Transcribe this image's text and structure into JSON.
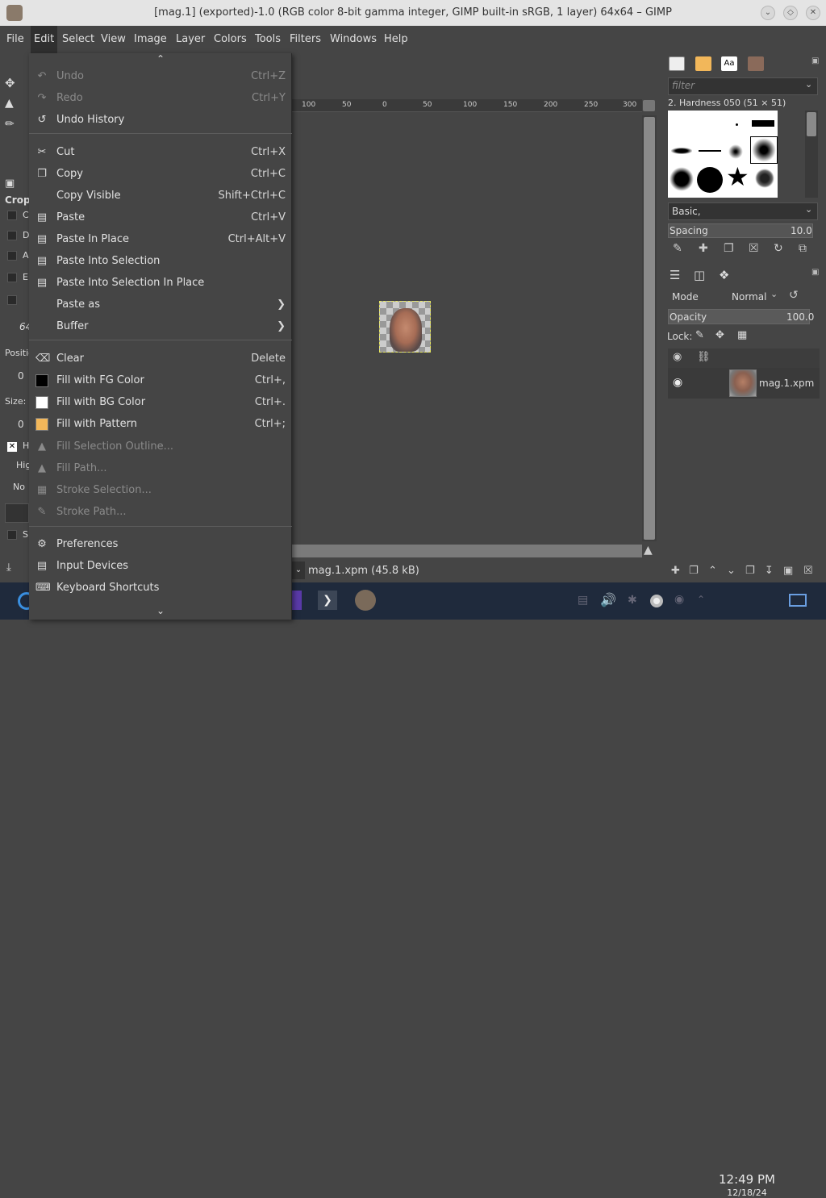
{
  "window": {
    "title": "[mag.1] (exported)-1.0 (RGB color 8-bit gamma integer, GIMP built-in sRGB, 1 layer) 64x64 – GIMP"
  },
  "menubar": [
    "File",
    "Edit",
    "Select",
    "View",
    "Image",
    "Layer",
    "Colors",
    "Tools",
    "Filters",
    "Windows",
    "Help"
  ],
  "edit_menu": {
    "items": [
      {
        "label": "Undo",
        "shortcut": "Ctrl+Z",
        "icon": "undo-icon",
        "disabled": true
      },
      {
        "label": "Redo",
        "shortcut": "Ctrl+Y",
        "icon": "redo-icon",
        "disabled": true
      },
      {
        "label": "Undo History",
        "shortcut": "",
        "icon": "undo-history-icon",
        "disabled": false
      },
      {
        "label": "Cut",
        "shortcut": "Ctrl+X",
        "icon": "scissors-icon",
        "disabled": false
      },
      {
        "label": "Copy",
        "shortcut": "Ctrl+C",
        "icon": "copy-icon",
        "disabled": false
      },
      {
        "label": "Copy Visible",
        "shortcut": "Shift+Ctrl+C",
        "icon": "",
        "disabled": false
      },
      {
        "label": "Paste",
        "shortcut": "Ctrl+V",
        "icon": "paste-icon",
        "disabled": false
      },
      {
        "label": "Paste In Place",
        "shortcut": "Ctrl+Alt+V",
        "icon": "paste-icon",
        "disabled": false
      },
      {
        "label": "Paste Into Selection",
        "shortcut": "",
        "icon": "paste-icon",
        "disabled": false
      },
      {
        "label": "Paste Into Selection In Place",
        "shortcut": "",
        "icon": "paste-icon",
        "disabled": false
      },
      {
        "label": "Paste as",
        "shortcut": "",
        "icon": "",
        "disabled": false,
        "submenu": true
      },
      {
        "label": "Buffer",
        "shortcut": "",
        "icon": "",
        "disabled": false,
        "submenu": true
      },
      {
        "label": "Clear",
        "shortcut": "Delete",
        "icon": "clear-icon",
        "disabled": false
      },
      {
        "label": "Fill with FG Color",
        "shortcut": "Ctrl+,",
        "icon": "fg-color-swatch",
        "color": "#000000",
        "disabled": false
      },
      {
        "label": "Fill with BG Color",
        "shortcut": "Ctrl+.",
        "icon": "bg-color-swatch",
        "color": "#ffffff",
        "disabled": false
      },
      {
        "label": "Fill with Pattern",
        "shortcut": "Ctrl+;",
        "icon": "pattern-swatch",
        "color": "#f2b75a",
        "disabled": false
      },
      {
        "label": "Fill Selection Outline...",
        "shortcut": "",
        "icon": "fill-icon",
        "disabled": true
      },
      {
        "label": "Fill Path...",
        "shortcut": "",
        "icon": "fill-icon",
        "disabled": true
      },
      {
        "label": "Stroke Selection...",
        "shortcut": "",
        "icon": "stroke-icon",
        "disabled": true
      },
      {
        "label": "Stroke Path...",
        "shortcut": "",
        "icon": "stroke-path-icon",
        "disabled": true
      },
      {
        "label": "Preferences",
        "shortcut": "",
        "icon": "preferences-icon",
        "disabled": false
      },
      {
        "label": "Input Devices",
        "shortcut": "",
        "icon": "input-devices-icon",
        "disabled": false
      },
      {
        "label": "Keyboard Shortcuts",
        "shortcut": "",
        "icon": "keyboard-icon",
        "disabled": false
      }
    ]
  },
  "tool_options": {
    "title": "Crop",
    "position_label": "Positio",
    "size_label": "Size:",
    "value_zero": "0",
    "value_64": "64",
    "high_label": "Hig",
    "no_label": "No",
    "letters": [
      "C",
      "D",
      "A",
      "E",
      "S",
      "H"
    ]
  },
  "canvas": {
    "ruler_ticks": [
      "100",
      "50",
      "0",
      "50",
      "100",
      "150",
      "200",
      "250",
      "300"
    ],
    "status_text": "mag.1.xpm (45.8 kB)"
  },
  "brushes": {
    "filter_placeholder": "filter",
    "selected_brush": "2. Hardness 050 (51 × 51)",
    "preset": "Basic,",
    "spacing_label": "Spacing",
    "spacing_value": "10.0"
  },
  "layers": {
    "mode_label": "Mode",
    "mode_value": "Normal",
    "opacity_label": "Opacity",
    "opacity_value": "100.0",
    "lock_label": "Lock:",
    "layer_name": "mag.1.xpm"
  },
  "taskbar": {
    "time": "12:49 PM",
    "date": "12/18/24"
  }
}
